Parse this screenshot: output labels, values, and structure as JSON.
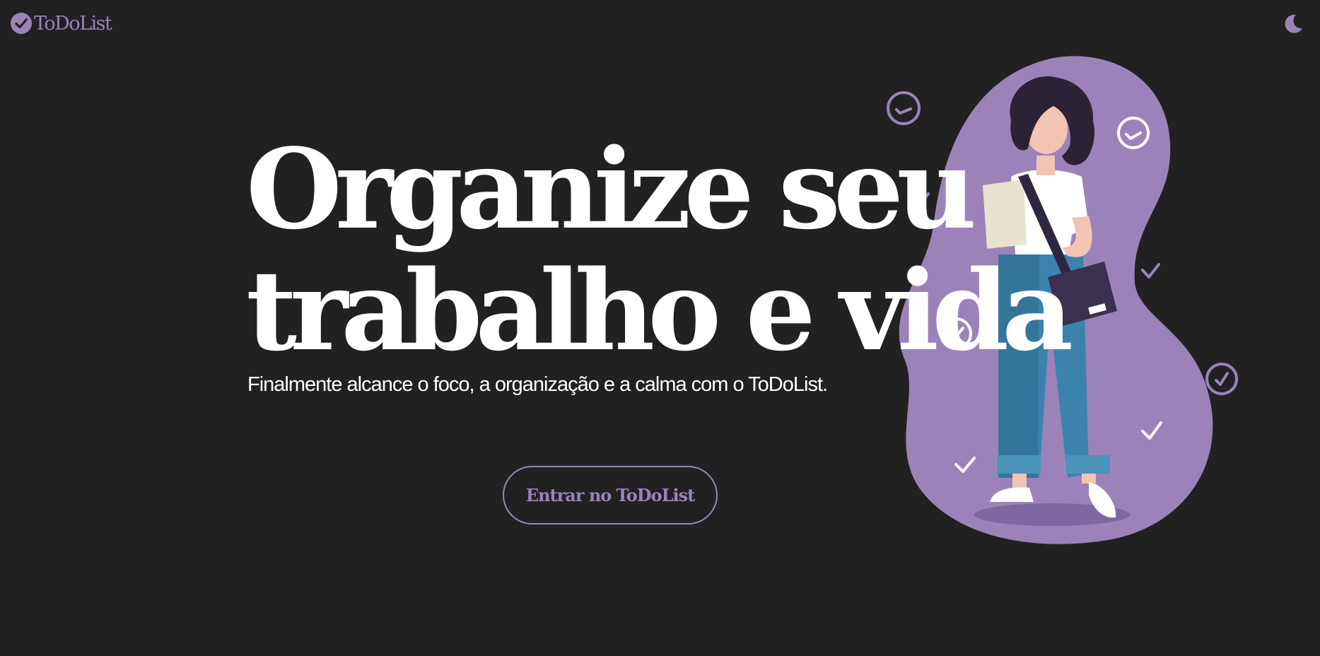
{
  "header": {
    "logo_text": "ToDoList",
    "logo_icon": "check-circle-icon",
    "theme_toggle_icon": "moon-icon"
  },
  "hero": {
    "title_line1": "Organize seu",
    "title_line2": "trabalho e vida",
    "subtitle": "Finalmente alcance o foco, a organização e a calma com o ToDoList.",
    "cta_label": "Entrar no ToDoList"
  },
  "illustration": {
    "description_icon": "woman-with-checklist-illustration"
  },
  "colors": {
    "background": "#212121",
    "accent": "#9b83b9",
    "text": "#ffffff"
  }
}
